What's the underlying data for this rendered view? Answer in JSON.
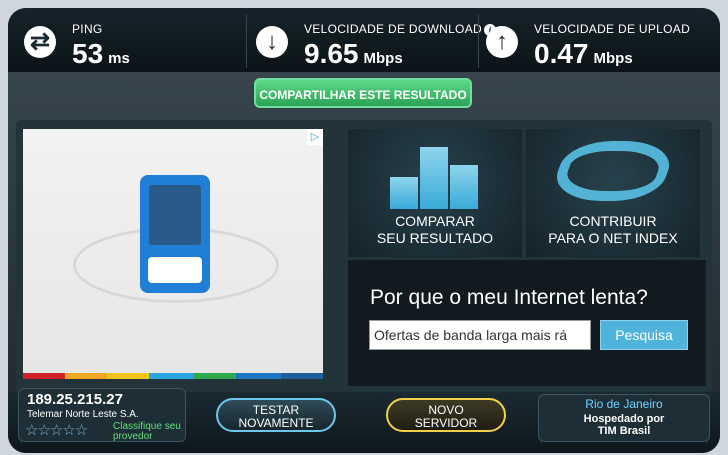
{
  "stats": {
    "ping": {
      "label": "PING",
      "value": "53",
      "unit": "ms",
      "icon": "arrows-exchange-icon"
    },
    "download": {
      "label": "VELOCIDADE DE DOWNLOAD",
      "value": "9.65",
      "unit": "Mbps",
      "icon": "arrow-down-icon"
    },
    "upload": {
      "label": "VELOCIDADE DE UPLOAD",
      "value": "0.47",
      "unit": "Mbps",
      "icon": "arrow-up-icon"
    }
  },
  "share_button": "COMPARTILHAR ESTE RESULTADO",
  "tiles": {
    "compare": {
      "line1": "COMPARAR",
      "line2": "SEU RESULTADO"
    },
    "contribute": {
      "line1": "CONTRIBUIR",
      "line2": "PARA O NET INDEX"
    }
  },
  "slow_box": {
    "question": "Por que o meu Internet lenta?",
    "input_value": "Ofertas de banda larga mais rá",
    "search_button": "Pesquisa"
  },
  "client": {
    "ip": "189.25.215.27",
    "isp": "Telemar Norte Leste S.A.",
    "rate_line1": "Classifique seu",
    "rate_line2": "provedor",
    "stars": "☆☆☆☆☆"
  },
  "buttons": {
    "test_again_1": "TESTAR",
    "test_again_2": "NOVAMENTE",
    "new_server_1": "NOVO",
    "new_server_2": "SERVIDOR"
  },
  "server": {
    "city": "Rio de Janeiro",
    "hosted_by": "Hospedado por",
    "host": "TIM Brasil"
  },
  "colors": {
    "accent_green": "#3cc46e",
    "accent_blue": "#4fb3db",
    "accent_gold": "#f2d04a"
  }
}
